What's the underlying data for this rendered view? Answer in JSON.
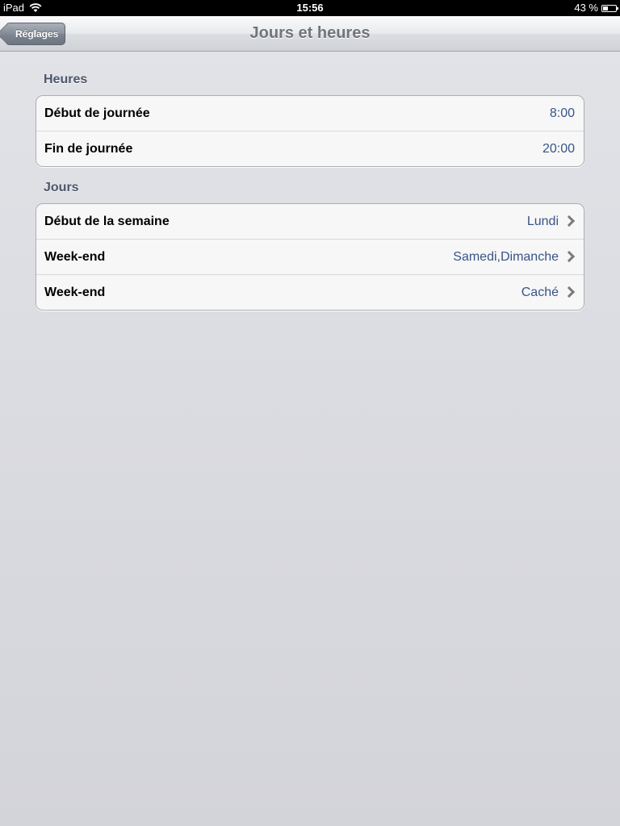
{
  "status_bar": {
    "device": "iPad",
    "time": "15:56",
    "battery": "43 %",
    "battery_level": 0.43,
    "icons": [
      "wifi-icon",
      "battery-icon"
    ]
  },
  "nav": {
    "back_label": "Réglages",
    "title": "Jours et heures"
  },
  "sections": {
    "hours": {
      "header": "Heures",
      "rows": [
        {
          "label": "Début de journée",
          "value": "8:00"
        },
        {
          "label": "Fin de journée",
          "value": "20:00"
        }
      ]
    },
    "days": {
      "header": "Jours",
      "rows": [
        {
          "label": "Début de la semaine",
          "value": "Lundi"
        },
        {
          "label": "Week-end",
          "value": "Samedi,Dimanche"
        },
        {
          "label": "Week-end",
          "value": "Caché"
        }
      ]
    }
  },
  "colors": {
    "value_text": "#385487",
    "section_header": "#4c566c",
    "nav_title": "#70757c"
  }
}
